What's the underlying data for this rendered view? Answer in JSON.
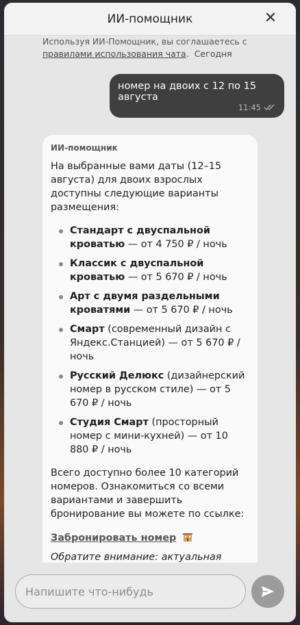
{
  "header": {
    "title": "ИИ-помощник",
    "close_label": "✕"
  },
  "consent": {
    "prefix": "Используя ИИ-Помощник, вы соглашаетесь с ",
    "link": "правилами использования чата",
    "suffix": ".",
    "date": "Сегодня"
  },
  "user_message": {
    "text": "номер на двоих с 12 по 15 августа",
    "time": "11:45"
  },
  "bot_message": {
    "author": "ИИ-помощник",
    "intro": "На выбранные вами даты (12–15 августа) для двоих взрослых доступны следующие варианты размещения:",
    "rooms": [
      {
        "name": "Стандарт с двуспальной кроватью",
        "rest": " — от 4 750 ₽ / ночь"
      },
      {
        "name": "Классик с двуспальной кроватью",
        "rest": " — от 5 670 ₽ / ночь"
      },
      {
        "name": "Арт с двумя раздельными кроватями",
        "rest": " — от 5 670 ₽ / ночь"
      },
      {
        "name": "Смарт",
        "rest": " (современный дизайн с Яндекс.Станцией) — от 5 670 ₽ / ночь"
      },
      {
        "name": "Русский Делюкс",
        "rest": " (дизайнерский номер в русском стиле) — от 5 670 ₽ / ночь"
      },
      {
        "name": "Студия Смарт",
        "rest": " (просторный номер с мини-кухней) — от 10 880 ₽ / ночь"
      }
    ],
    "summary": "Всего доступно более 10 категорий номеров. Ознакомиться со всеми вариантами и завершить бронирование вы можете по ссылке:",
    "book_link": "Забронировать номер",
    "note": "Обратите внимание: актуальная стоимость и наличие мест проверяются в режиме реального времени в модуле бронирования."
  },
  "composer": {
    "placeholder": "Напишите что-нибудь"
  },
  "icons": {
    "close": "close-icon",
    "read_status": "double-check-icon",
    "hotel": "hotel-icon",
    "send": "send-icon"
  },
  "colors": {
    "user_bubble": "#3f3f3f",
    "bot_bubble": "#fafafa",
    "send_button": "#9c9c9c"
  }
}
